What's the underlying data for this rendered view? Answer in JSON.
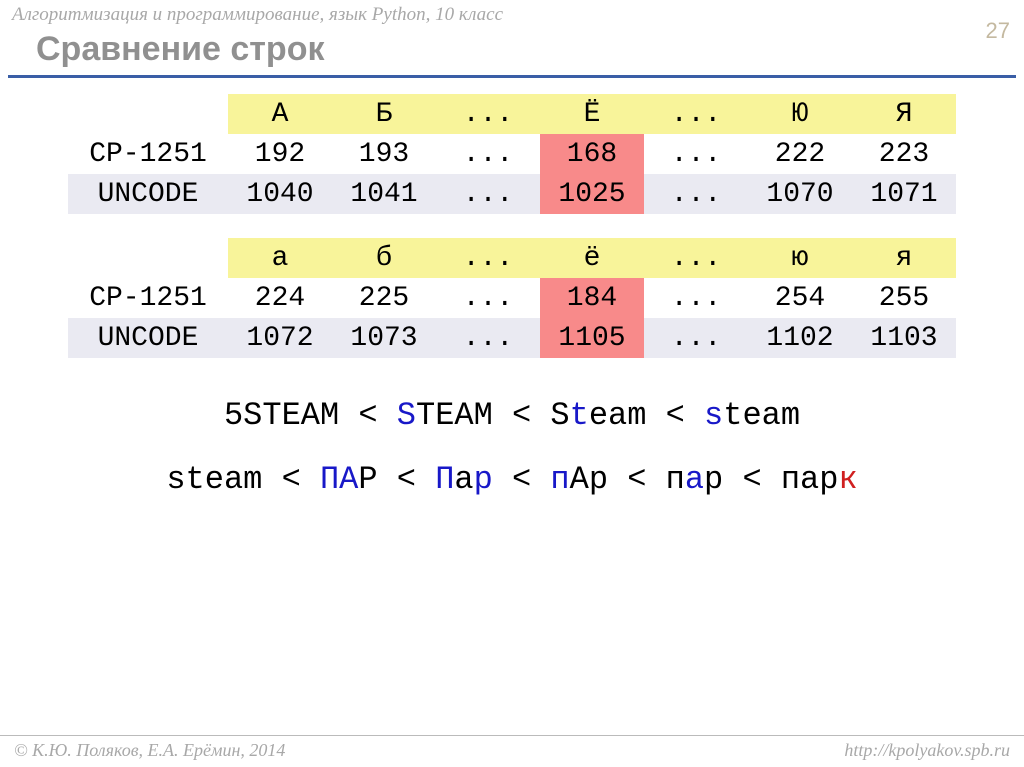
{
  "header": "Алгоритмизация и программирование, язык Python, 10 класс",
  "page_num": "27",
  "title": "Сравнение строк",
  "table_upper": {
    "headers": [
      "А",
      "Б",
      "...",
      "Ё",
      "...",
      "Ю",
      "Я"
    ],
    "rows": [
      {
        "label": "CP-1251",
        "cells": [
          "192",
          "193",
          "...",
          "168",
          "...",
          "222",
          "223"
        ],
        "hl": 3
      },
      {
        "label": "UNCODE",
        "cells": [
          "1040",
          "1041",
          "...",
          "1025",
          "...",
          "1070",
          "1071"
        ],
        "hl": 3
      }
    ]
  },
  "table_lower": {
    "headers": [
      "а",
      "б",
      "...",
      "ё",
      "...",
      "ю",
      "я"
    ],
    "rows": [
      {
        "label": "CP-1251",
        "cells": [
          "224",
          "225",
          "...",
          "184",
          "...",
          "254",
          "255"
        ],
        "hl": 3
      },
      {
        "label": "UNCODE",
        "cells": [
          "1072",
          "1073",
          "...",
          "1105",
          "...",
          "1102",
          "1103"
        ],
        "hl": 3
      }
    ]
  },
  "example1": {
    "parts": [
      {
        "t": "5STEAM < ",
        "c": ""
      },
      {
        "t": "S",
        "c": "b"
      },
      {
        "t": "TEAM < S",
        "c": ""
      },
      {
        "t": "t",
        "c": "b"
      },
      {
        "t": "eam < ",
        "c": ""
      },
      {
        "t": "s",
        "c": "b"
      },
      {
        "t": "team",
        "c": ""
      }
    ]
  },
  "example2": {
    "parts": [
      {
        "t": "steam < ",
        "c": ""
      },
      {
        "t": "ПА",
        "c": "b"
      },
      {
        "t": "Р < ",
        "c": ""
      },
      {
        "t": "П",
        "c": "b"
      },
      {
        "t": "а",
        "c": ""
      },
      {
        "t": "р",
        "c": "b"
      },
      {
        "t": " < ",
        "c": ""
      },
      {
        "t": "п",
        "c": "b"
      },
      {
        "t": "Ар < п",
        "c": ""
      },
      {
        "t": "а",
        "c": "b"
      },
      {
        "t": "р < пар",
        "c": ""
      },
      {
        "t": "к",
        "c": "r"
      }
    ]
  },
  "footer_left": "© К.Ю. Поляков, Е.А. Ерёмин, 2014",
  "footer_right": "http://kpolyakov.spb.ru"
}
